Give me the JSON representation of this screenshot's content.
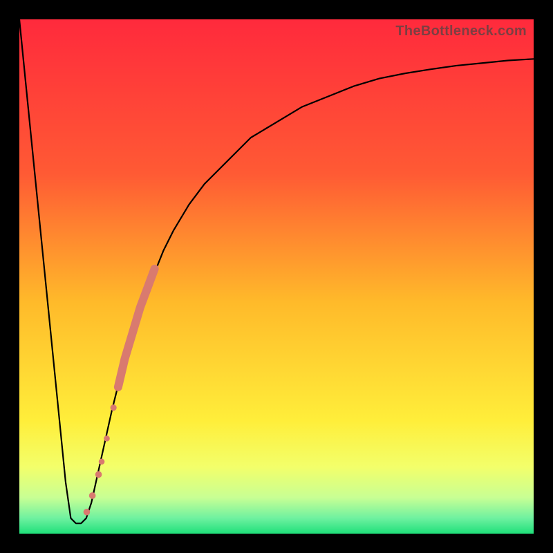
{
  "watermark": "TheBottleneck.com",
  "chart_data": {
    "type": "line",
    "title": "",
    "xlabel": "",
    "ylabel": "",
    "xlim": [
      0,
      100
    ],
    "ylim": [
      0,
      100
    ],
    "grid": false,
    "legend": false,
    "gradient_stops": [
      {
        "offset": 0.0,
        "color": "#ff2a3c"
      },
      {
        "offset": 0.3,
        "color": "#ff5a34"
      },
      {
        "offset": 0.55,
        "color": "#ffba2a"
      },
      {
        "offset": 0.78,
        "color": "#ffee3a"
      },
      {
        "offset": 0.87,
        "color": "#f3ff6a"
      },
      {
        "offset": 0.93,
        "color": "#c8ff94"
      },
      {
        "offset": 0.97,
        "color": "#6ef1a0"
      },
      {
        "offset": 1.0,
        "color": "#1fe07a"
      }
    ],
    "series": [
      {
        "name": "bottleneck-curve",
        "stroke": "#000000",
        "stroke_width": 2.2,
        "x": [
          0,
          2,
          4,
          6,
          8,
          9,
          10,
          11,
          12,
          13,
          14,
          16,
          18,
          20,
          22,
          24,
          26,
          28,
          30,
          33,
          36,
          40,
          45,
          50,
          55,
          60,
          65,
          70,
          75,
          80,
          85,
          90,
          95,
          100
        ],
        "y": [
          100,
          80,
          60,
          40,
          20,
          10,
          3,
          2,
          2,
          3,
          6,
          15,
          24,
          32,
          39,
          45,
          50,
          55,
          59,
          64,
          68,
          72,
          77,
          80,
          83,
          85,
          87,
          88.5,
          89.5,
          90.3,
          91,
          91.5,
          92,
          92.3
        ]
      }
    ],
    "markers": [
      {
        "name": "dot",
        "x": 13.1,
        "y": 4.2,
        "r": 4.8,
        "color": "#d97a6f"
      },
      {
        "name": "dot",
        "x": 14.2,
        "y": 7.4,
        "r": 4.8,
        "color": "#d97a6f"
      },
      {
        "name": "dot",
        "x": 15.4,
        "y": 11.5,
        "r": 4.8,
        "color": "#d97a6f"
      },
      {
        "name": "dot",
        "x": 16.0,
        "y": 14.0,
        "r": 4.3,
        "color": "#d97a6f"
      },
      {
        "name": "dot",
        "x": 17.0,
        "y": 18.5,
        "r": 4.3,
        "color": "#d97a6f"
      },
      {
        "name": "dot",
        "x": 18.3,
        "y": 24.5,
        "r": 4.6,
        "color": "#d97a6f"
      },
      {
        "name": "dot",
        "x": 19.2,
        "y": 28.5,
        "r": 4.6,
        "color": "#d97a6f"
      }
    ],
    "marker_band": {
      "name": "band",
      "color": "#d97a6f",
      "width": 12,
      "x": [
        19.2,
        20.5,
        22.0,
        23.5,
        25.0,
        26.3
      ],
      "y": [
        28.5,
        34.0,
        39.0,
        44.0,
        48.0,
        51.5
      ]
    }
  }
}
